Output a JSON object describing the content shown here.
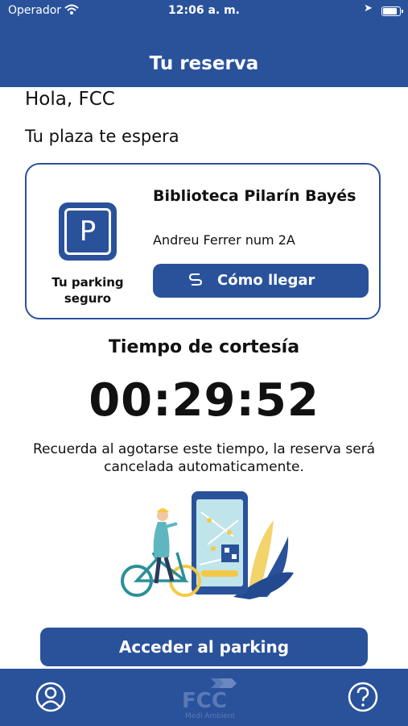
{
  "status_bar": {
    "carrier": "Operador",
    "time": "12:06 a. m."
  },
  "header": {
    "title": "Tu reserva"
  },
  "greeting": "Hola, FCC",
  "subtitle": "Tu plaza te espera",
  "card": {
    "icon": "parking-icon",
    "icon_letter": "P",
    "icon_label": "Tu parking seguro",
    "place_name": "Biblioteca Pilarín Bayés",
    "address": "Andreu Ferrer num 2A",
    "route_button": {
      "icon": "route-icon",
      "label": "Cómo llegar"
    }
  },
  "courtesy": {
    "title": "Tiempo de cortesía",
    "timer": "00:29:52",
    "note": "Recuerda al agotarse este tiempo, la reserva será cancelada automaticamente."
  },
  "access_button": "Acceder al parking",
  "bottom_nav": {
    "left_icon": "user-icon",
    "logo": {
      "text": "FCC",
      "subtext": "Medi Ambient"
    },
    "right_icon": "help-icon"
  },
  "colors": {
    "primary": "#2a529b",
    "background": "#ffffff",
    "text": "#111111"
  }
}
